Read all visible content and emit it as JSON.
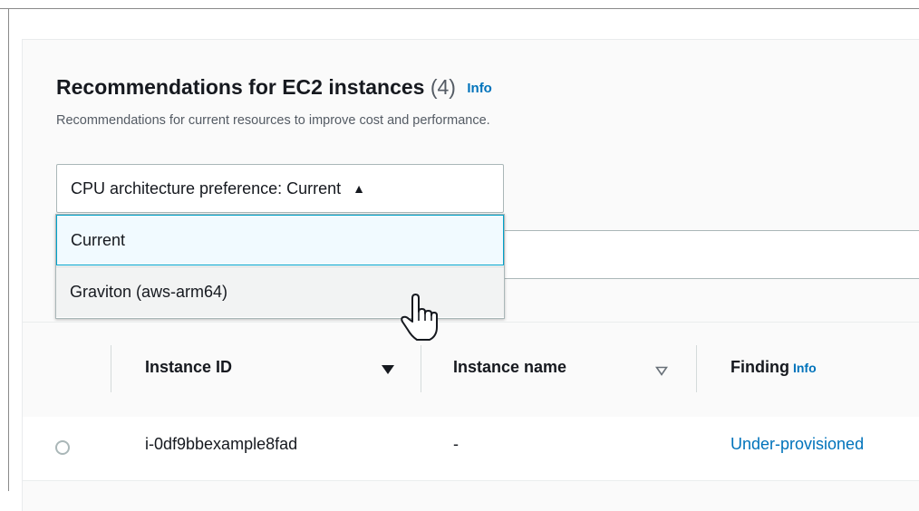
{
  "header": {
    "title": "Recommendations for EC2 instances",
    "count": "(4)",
    "info_link": "Info",
    "description": "Recommendations for current resources to improve cost and performance."
  },
  "filter": {
    "select_label": "CPU architecture preference: Current",
    "options": [
      {
        "label": "Current"
      },
      {
        "label": "Graviton (aws-arm64)"
      }
    ]
  },
  "table": {
    "columns": [
      {
        "label": "Instance ID",
        "sort": "descending"
      },
      {
        "label": "Instance name",
        "sort": "none"
      },
      {
        "label": "Finding",
        "info": "Info"
      }
    ],
    "rows": [
      {
        "instance_id": "i-0df9bbexample8fad",
        "instance_name": "-",
        "finding": "Under-provisioned"
      }
    ]
  },
  "colors": {
    "link": "#0073bb",
    "selected_border": "#00a1c9",
    "text": "#16191f",
    "muted": "#545b64"
  },
  "icons": [
    "caret-up-icon",
    "sort-descending-icon",
    "sort-unsorted-icon",
    "hand-pointer-cursor-icon",
    "radio-button-icon"
  ]
}
